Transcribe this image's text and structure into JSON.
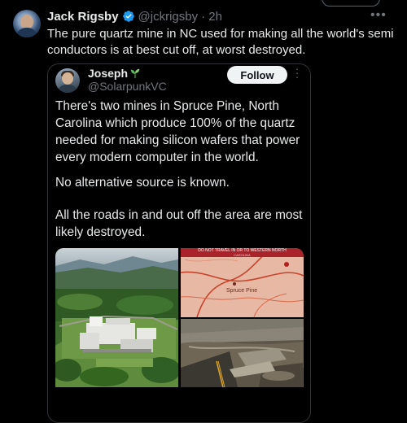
{
  "outer_tweet": {
    "author_name": "Jack Rigsby",
    "handle": "@jckrigsby",
    "time": "· 2h",
    "text": "The pure quartz mine in NC used for making all the world's semi conductors is at best cut off, at worst destroyed."
  },
  "quoted_tweet": {
    "author_name": "Joseph",
    "handle": "@SolarpunkVC",
    "follow_label": "Follow",
    "paragraphs": [
      "There's two mines in Spruce Pine, North Carolina which produce 100% of the quartz needed for making silicon wafers that power every modern computer in the world.",
      "No alternative source is known.",
      "All the roads in and out off the area are most likely destroyed."
    ],
    "map_banner_text": "DO NOT TRAVEL IN OR TO WESTERN NORTH",
    "map_banner_subtext": "CAROLINA",
    "map_place_label": "Spruce Pine"
  },
  "icons": {
    "verified": "verified-badge-icon",
    "emoji": "seedling-emoji-icon",
    "more": "more-options-icon"
  },
  "colors": {
    "background": "#000000",
    "text": "#e7e9ea",
    "secondary": "#71767b",
    "verified": "#1d9bf0",
    "border": "#2f3336"
  }
}
